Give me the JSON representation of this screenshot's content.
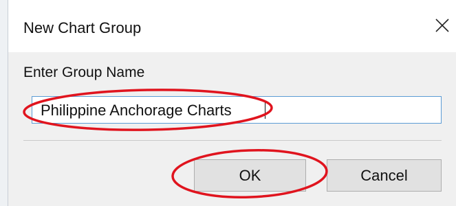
{
  "dialog": {
    "title": "New Chart Group",
    "close_icon": "close-icon",
    "label": "Enter Group Name",
    "input_value": "Philippine Anchorage Charts",
    "ok_label": "OK",
    "cancel_label": "Cancel"
  },
  "colors": {
    "annotation": "#e0141e",
    "input_border": "#5b9bd5",
    "button_face": "#e1e1e1",
    "dialog_body": "#f0f0f0"
  }
}
